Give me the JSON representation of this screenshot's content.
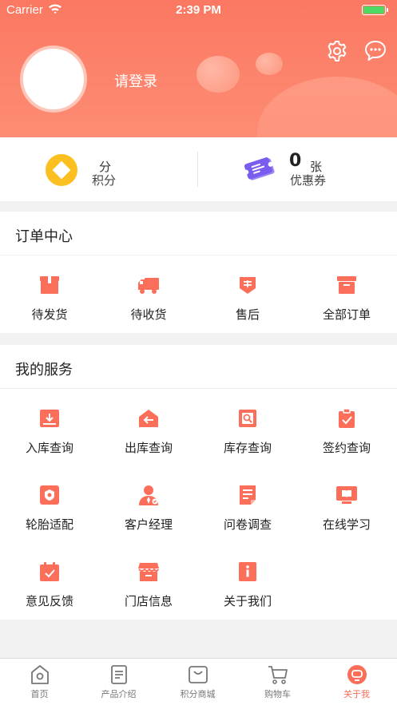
{
  "status_bar": {
    "carrier": "Carrier",
    "time": "2:39 PM",
    "battery_level": 1.0
  },
  "header": {
    "login_label": "请登录"
  },
  "stats": {
    "points": {
      "unit": "分",
      "label": "积分"
    },
    "coupons": {
      "count": "0",
      "unit": "张",
      "label": "优惠券"
    }
  },
  "orders": {
    "title": "订单中心",
    "items": [
      {
        "label": "待发货",
        "icon": "package-icon"
      },
      {
        "label": "待收货",
        "icon": "truck-icon"
      },
      {
        "label": "售后",
        "icon": "after-sales-icon"
      },
      {
        "label": "全部订单",
        "icon": "archive-box-icon"
      }
    ]
  },
  "services": {
    "title": "我的服务",
    "items": [
      {
        "label": "入库查询",
        "icon": "inbound-icon"
      },
      {
        "label": "出库查询",
        "icon": "outbound-icon"
      },
      {
        "label": "库存查询",
        "icon": "inventory-search-icon"
      },
      {
        "label": "签约查询",
        "icon": "contract-check-icon"
      },
      {
        "label": "轮胎适配",
        "icon": "tire-icon"
      },
      {
        "label": "客户经理",
        "icon": "manager-icon"
      },
      {
        "label": "问卷调查",
        "icon": "survey-icon"
      },
      {
        "label": "在线学习",
        "icon": "online-learning-icon"
      },
      {
        "label": "意见反馈",
        "icon": "feedback-icon"
      },
      {
        "label": "门店信息",
        "icon": "store-icon"
      },
      {
        "label": "关于我们",
        "icon": "about-icon"
      }
    ]
  },
  "tabbar": {
    "items": [
      {
        "label": "首页",
        "icon": "home-icon",
        "active": false
      },
      {
        "label": "产品介绍",
        "icon": "product-icon",
        "active": false
      },
      {
        "label": "积分商城",
        "icon": "shopping-bag-icon",
        "active": false
      },
      {
        "label": "购物车",
        "icon": "cart-icon",
        "active": false
      },
      {
        "label": "关于我",
        "icon": "profile-icon",
        "active": true
      }
    ]
  },
  "colors": {
    "accent": "#fb6f5a",
    "header_top": "#fb7862",
    "header_bottom": "#fd8c74",
    "coin": "#fcbf20",
    "coupon": "#7b5cf0"
  }
}
